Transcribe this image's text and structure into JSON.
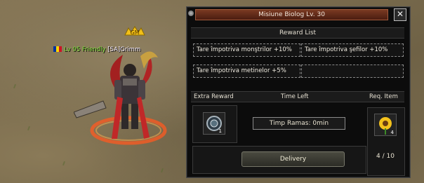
{
  "player": {
    "level_text": "Lv 95 Friendly",
    "guild_name": "[SA]Grimm",
    "gm_tag": "GM"
  },
  "window": {
    "title": "Misiune Biolog Lv. 30",
    "close_label": "✕",
    "reward_list_label": "Reward List",
    "rewards": [
      "Tare împotriva monştrilor +10%",
      "Tare împotriva şefilor +10%",
      "Tare împotriva metinelor +5%",
      ""
    ],
    "extra_reward_label": "Extra Reward",
    "time_left_label": "Time Left",
    "req_item_label": "Req. Item",
    "extra_reward_item_count": "1",
    "req_item_count": "4",
    "timer_text": "Timp Ramas: 0min",
    "delivery_label": "Delivery",
    "progress_text": "4 / 10"
  }
}
